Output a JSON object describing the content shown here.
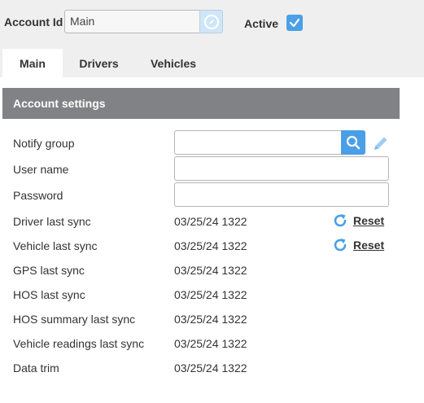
{
  "header": {
    "account_id_label": "Account Id",
    "account_id_value": "Main",
    "active_label": "Active",
    "active_checked": true
  },
  "tabs": [
    {
      "label": "Main",
      "active": true
    },
    {
      "label": "Drivers",
      "active": false
    },
    {
      "label": "Vehicles",
      "active": false
    }
  ],
  "section": {
    "title": "Account settings"
  },
  "form": {
    "notify_group_label": "Notify group",
    "user_name_label": "User name",
    "password_label": "Password"
  },
  "syncs": [
    {
      "label": "Driver last sync",
      "value": "03/25/24 1322",
      "reset": "Reset"
    },
    {
      "label": "Vehicle last sync",
      "value": "03/25/24 1322",
      "reset": "Reset"
    },
    {
      "label": "GPS last sync",
      "value": "03/25/24 1322"
    },
    {
      "label": "HOS last sync",
      "value": "03/25/24 1322"
    },
    {
      "label": "HOS summary last sync",
      "value": "03/25/24 1322"
    },
    {
      "label": "Vehicle readings last sync",
      "value": "03/25/24 1322"
    },
    {
      "label": "Data trim",
      "value": "03/25/24 1322"
    }
  ],
  "colors": {
    "accent": "#4a9fe6",
    "section_header": "#808285",
    "top_bar": "#efefef"
  }
}
